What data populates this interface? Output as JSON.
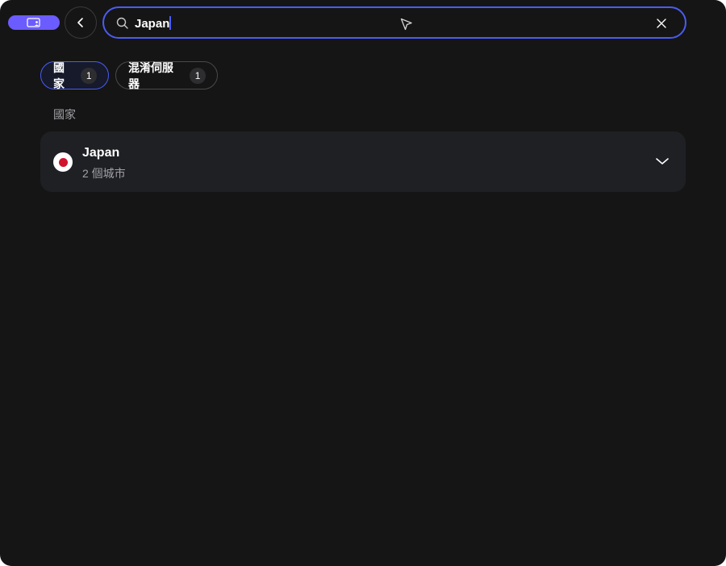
{
  "search": {
    "value": "Japan",
    "accent_color": "#4a5cf5"
  },
  "toolbar": {
    "toggle_color": "#6b5cff",
    "toggle_icon": "display-user-icon",
    "back_icon": "chevron-left-icon",
    "clear_icon": "close-icon"
  },
  "filters": [
    {
      "label": "國家",
      "count": "1",
      "selected": true
    },
    {
      "label": "混淆伺服器",
      "count": "1",
      "selected": false
    }
  ],
  "results": {
    "section_label": "國家",
    "items": [
      {
        "name": "Japan",
        "subtitle": "2 個城市",
        "flag_icon": "japan-flag-icon",
        "expand_icon": "chevron-down-icon"
      }
    ]
  }
}
